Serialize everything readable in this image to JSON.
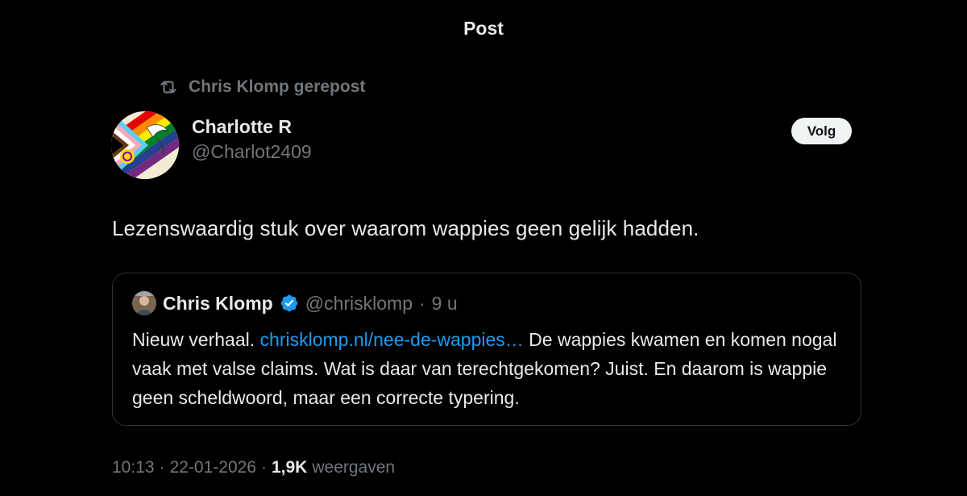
{
  "header": {
    "title": "Post"
  },
  "repost": {
    "icon": "repost-icon",
    "text": "Chris Klomp gerepost"
  },
  "author": {
    "name": "Charlotte R",
    "handle": "@Charlot2409",
    "avatar": "progress-pride-flag-avatar"
  },
  "follow_button": {
    "label": "Volg"
  },
  "post": {
    "text": "Lezenswaardig stuk over waarom wappies geen gelijk hadden."
  },
  "quote": {
    "author_name": "Chris Klomp",
    "verified_icon": "verified-badge-icon",
    "handle": "@chrisklomp",
    "separator": "·",
    "time": "9 u",
    "body_before": "Nieuw verhaal. ",
    "link_text": "chrisklomp.nl/nee-de-wappies…",
    "body_after": " De wappies kwamen en komen nogal vaak met valse claims. Wat is daar van terechtgekomen? Juist. En daarom is wappie geen scheldwoord, maar een correcte typering."
  },
  "meta": {
    "time": "10:13",
    "sep1": "·",
    "date": "22-01-2026",
    "sep2": "·",
    "views": "1,9K",
    "views_label": "weergaven"
  },
  "colors": {
    "background": "#000000",
    "text_primary": "#e7e9ea",
    "text_secondary": "#71767b",
    "link": "#1d9bf0",
    "verified": "#1d9bf0",
    "border": "#2f3336"
  }
}
